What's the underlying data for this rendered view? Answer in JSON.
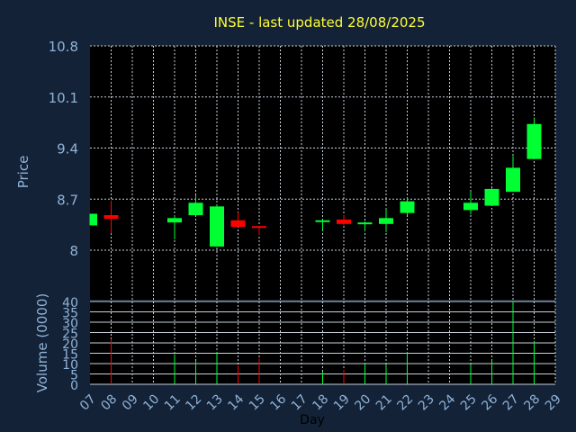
{
  "chart_data": [
    {
      "type": "candlestick",
      "title": "INSE - last updated 28/08/2025",
      "ylabel": "Price",
      "ylim": [
        8.0,
        10.8
      ],
      "yticks": [
        "10.8",
        "10.1",
        "9.4",
        "8.7",
        "8"
      ],
      "grid": true,
      "candles": [
        {
          "day": 7,
          "open": 8.34,
          "close": 8.5,
          "high": 8.5,
          "low": 8.34,
          "direction": "up"
        },
        {
          "day": 8,
          "open": 8.48,
          "close": 8.43,
          "high": 8.68,
          "low": 8.23,
          "direction": "down"
        },
        {
          "day": 11,
          "open": 8.38,
          "close": 8.44,
          "high": 8.48,
          "low": 8.15,
          "direction": "up"
        },
        {
          "day": 12,
          "open": 8.48,
          "close": 8.65,
          "high": 8.75,
          "low": 8.48,
          "direction": "up"
        },
        {
          "day": 13,
          "open": 8.05,
          "close": 8.6,
          "high": 8.62,
          "low": 8.05,
          "direction": "up"
        },
        {
          "day": 14,
          "open": 8.41,
          "close": 8.32,
          "high": 8.52,
          "low": 8.32,
          "direction": "down"
        },
        {
          "day": 15,
          "open": 8.33,
          "close": 8.31,
          "high": 8.33,
          "low": 8.21,
          "direction": "down"
        },
        {
          "day": 18,
          "open": 8.4,
          "close": 8.41,
          "high": 8.42,
          "low": 8.27,
          "direction": "up"
        },
        {
          "day": 19,
          "open": 8.42,
          "close": 8.36,
          "high": 8.48,
          "low": 8.34,
          "direction": "down"
        },
        {
          "day": 20,
          "open": 8.36,
          "close": 8.38,
          "high": 8.4,
          "low": 8.26,
          "direction": "up"
        },
        {
          "day": 21,
          "open": 8.36,
          "close": 8.44,
          "high": 8.57,
          "low": 8.25,
          "direction": "up"
        },
        {
          "day": 22,
          "open": 8.51,
          "close": 8.67,
          "high": 8.72,
          "low": 8.48,
          "direction": "up"
        },
        {
          "day": 25,
          "open": 8.55,
          "close": 8.65,
          "high": 8.81,
          "low": 8.49,
          "direction": "up"
        },
        {
          "day": 26,
          "open": 8.61,
          "close": 8.84,
          "high": 8.85,
          "low": 8.61,
          "direction": "up"
        },
        {
          "day": 27,
          "open": 8.8,
          "close": 9.13,
          "high": 9.29,
          "low": 8.8,
          "direction": "up"
        },
        {
          "day": 28,
          "open": 9.25,
          "close": 9.73,
          "high": 9.82,
          "low": 9.25,
          "direction": "up"
        }
      ]
    },
    {
      "type": "bar",
      "xlabel": "Day",
      "ylabel": "Volume (0000)",
      "ylim": [
        0,
        40
      ],
      "yticks": [
        "0",
        "5",
        "10",
        "15",
        "20",
        "25",
        "30",
        "35",
        "40"
      ],
      "x_categories": [
        "07",
        "08",
        "09",
        "10",
        "11",
        "12",
        "13",
        "14",
        "15",
        "16",
        "17",
        "18",
        "19",
        "20",
        "21",
        "22",
        "23",
        "24",
        "25",
        "26",
        "27",
        "28",
        "29"
      ],
      "bars": [
        {
          "day": 8,
          "value": 22,
          "direction": "down"
        },
        {
          "day": 11,
          "value": 14.5,
          "direction": "up"
        },
        {
          "day": 12,
          "value": 11.5,
          "direction": "up"
        },
        {
          "day": 13,
          "value": 15.5,
          "direction": "up"
        },
        {
          "day": 14,
          "value": 9,
          "direction": "down"
        },
        {
          "day": 15,
          "value": 12.5,
          "direction": "down"
        },
        {
          "day": 18,
          "value": 6,
          "direction": "up"
        },
        {
          "day": 19,
          "value": 7,
          "direction": "down"
        },
        {
          "day": 20,
          "value": 10,
          "direction": "up"
        },
        {
          "day": 21,
          "value": 9.5,
          "direction": "up"
        },
        {
          "day": 22,
          "value": 15.5,
          "direction": "up"
        },
        {
          "day": 25,
          "value": 9.5,
          "direction": "up"
        },
        {
          "day": 26,
          "value": 12,
          "direction": "up"
        },
        {
          "day": 27,
          "value": 40,
          "direction": "up"
        },
        {
          "day": 28,
          "value": 21,
          "direction": "up"
        }
      ]
    }
  ],
  "colors": {
    "background": "#132236",
    "plot_background": "#000000",
    "grid": "#c8d2dc",
    "up": "#00ff33",
    "down": "#ff0000",
    "title": "#ffff33",
    "axis_text": "#8fb3d9"
  }
}
